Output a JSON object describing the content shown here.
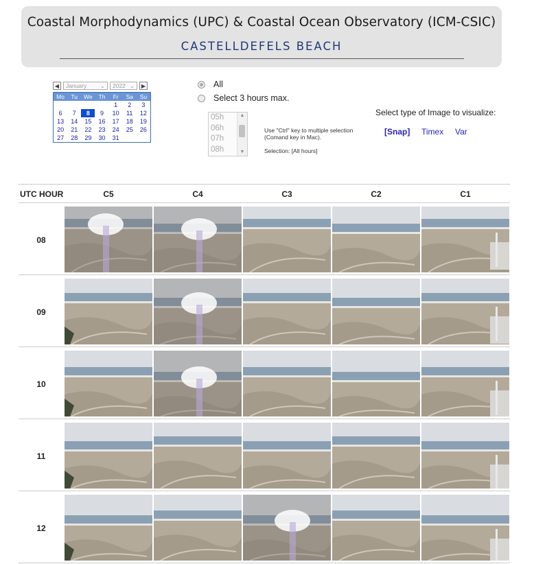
{
  "header": {
    "title": "Coastal Morphodynamics (UPC) & Coastal Ocean Observatory (ICM-CSIC)",
    "subtitle": "CASTELLDEFELS  BEACH"
  },
  "calendar": {
    "prev": "◀",
    "next": "▶",
    "month": "January",
    "year": "2022",
    "weekdays": [
      "Mo",
      "Tu",
      "We",
      "Th",
      "Fr",
      "Sa",
      "Su"
    ],
    "weeks": [
      [
        "",
        "",
        "",
        "",
        "1",
        "2",
        "3"
      ],
      [
        "6",
        "7",
        "8",
        "9",
        "10",
        "11",
        "12"
      ],
      [
        "13",
        "14",
        "15",
        "16",
        "17",
        "18",
        "19"
      ],
      [
        "20",
        "21",
        "22",
        "23",
        "24",
        "25",
        "26"
      ],
      [
        "27",
        "28",
        "29",
        "30",
        "31",
        "",
        ""
      ]
    ],
    "selected_day": "8"
  },
  "filters": {
    "all_label": "All",
    "select_label": "Select 3 hours max.",
    "hours": [
      "05h",
      "06h",
      "07h",
      "08h"
    ],
    "hint": "Use \"Ctrl\" key to multiple selection (Comand key in Mac).",
    "selection": "Selection: [All hours]"
  },
  "image_type": {
    "label": "Select type of Image to visualize:",
    "snap": "[Snap]",
    "timex": "Timex",
    "var": "Var"
  },
  "table": {
    "utc_header": "UTC HOUR",
    "columns": [
      "C5",
      "C4",
      "C3",
      "C2",
      "C1"
    ],
    "rows": [
      "08",
      "09",
      "10",
      "11",
      "12"
    ]
  }
}
